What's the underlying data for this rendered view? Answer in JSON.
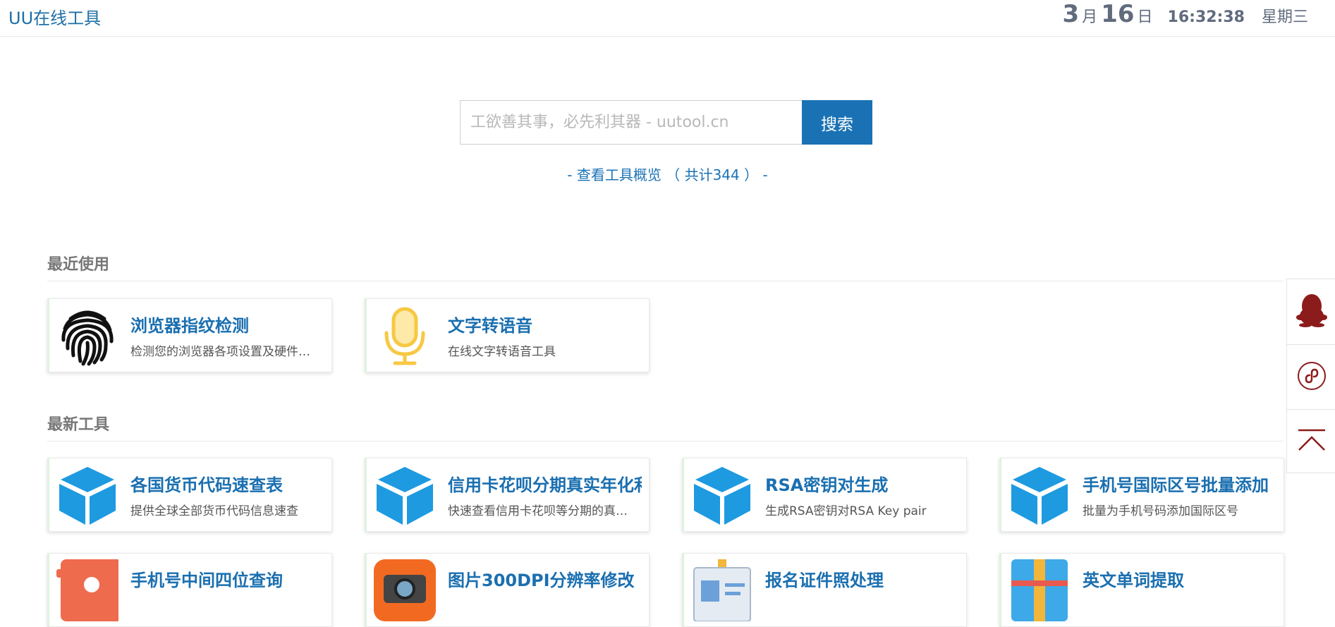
{
  "header": {
    "brand": "UU在线工具",
    "date_month": "3",
    "month_unit": "月",
    "date_day": "16",
    "day_unit": "日",
    "time": "16:32:38",
    "weekday": "星期三"
  },
  "search": {
    "placeholder": "工欲善其事，必先利其器 - uutool.cn",
    "button_label": "搜索",
    "overview_link": "- 查看工具概览 （ 共计344 ） -"
  },
  "sections": {
    "recent": {
      "title": "最近使用",
      "items": [
        {
          "title": "浏览器指纹检测",
          "desc": "检测您的浏览器各项设置及硬件信息",
          "icon": "fingerprint-icon"
        },
        {
          "title": "文字转语音",
          "desc": "在线文字转语音工具",
          "icon": "microphone-icon"
        }
      ]
    },
    "latest": {
      "title": "最新工具",
      "items": [
        {
          "title": "各国货币代码速查表",
          "desc": "提供全球全部货币代码信息速查",
          "icon": "cube-icon"
        },
        {
          "title": "信用卡花呗分期真实年化利率计算",
          "desc": "快速查看信用卡花呗等分期的真实利率",
          "icon": "cube-icon"
        },
        {
          "title": "RSA密钥对生成",
          "desc": "生成RSA密钥对RSA Key pair",
          "icon": "cube-icon"
        },
        {
          "title": "手机号国际区号批量添加",
          "desc": "批量为手机号码添加国际区号",
          "icon": "cube-icon"
        },
        {
          "title": "手机号中间四位查询",
          "desc": "",
          "icon": "phone-icon"
        },
        {
          "title": "图片300DPI分辨率修改",
          "desc": "",
          "icon": "camera-icon"
        },
        {
          "title": "报名证件照处理",
          "desc": "",
          "icon": "id-photo-icon"
        },
        {
          "title": "英文单词提取",
          "desc": "",
          "icon": "document-icon"
        }
      ]
    }
  },
  "sidebar": {
    "items": [
      {
        "icon": "qq-penguin-icon"
      },
      {
        "icon": "mini-program-icon"
      },
      {
        "icon": "back-to-top-icon"
      }
    ]
  },
  "colors": {
    "brand_blue": "#1a72b5",
    "title_blue": "#1a6fb0",
    "cube_blue": "#1e9ae0",
    "mic_yellow": "#f7c843",
    "side_red": "#8c1b1b"
  }
}
